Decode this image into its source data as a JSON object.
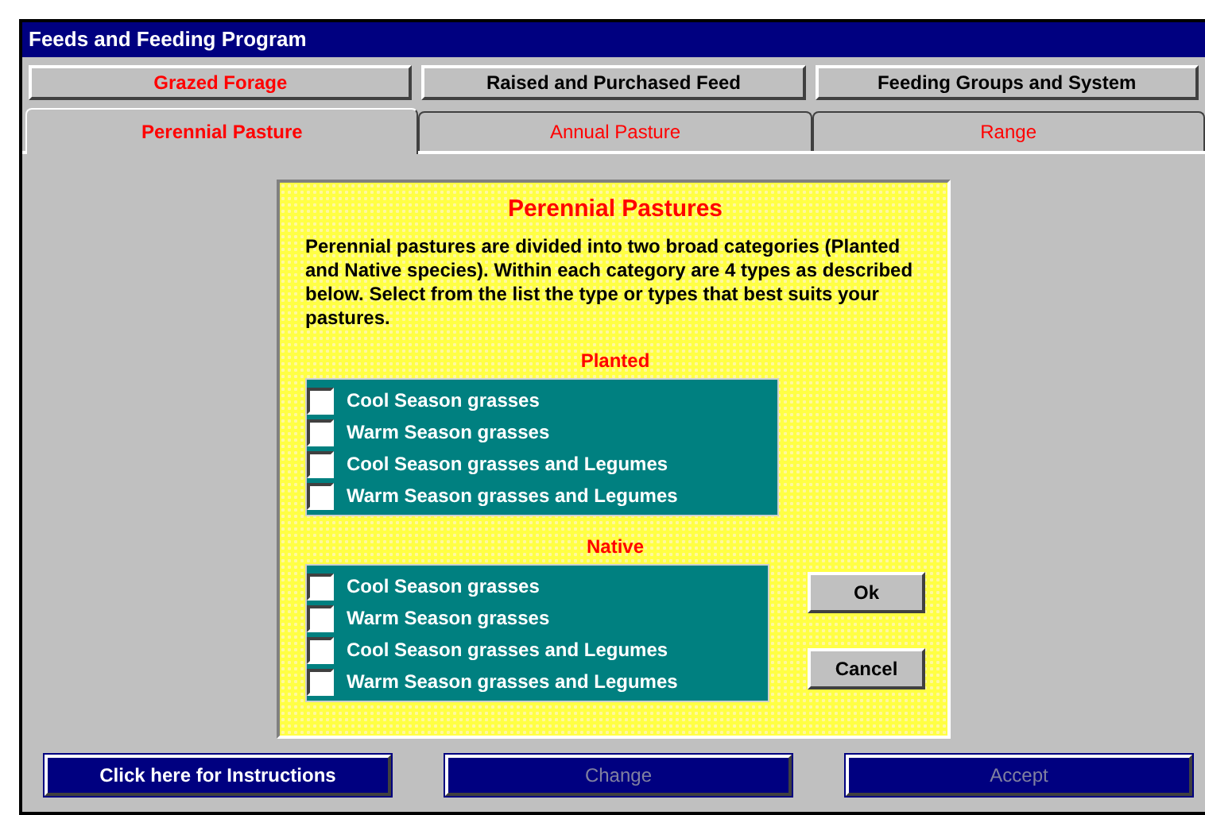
{
  "window": {
    "title": "Feeds and Feeding Program"
  },
  "sections": [
    {
      "label": "Grazed Forage",
      "selected": true
    },
    {
      "label": "Raised and Purchased Feed",
      "selected": false
    },
    {
      "label": "Feeding Groups and System",
      "selected": false
    }
  ],
  "tabs": [
    {
      "label": "Perennial Pasture",
      "selected": true
    },
    {
      "label": "Annual Pasture",
      "selected": false
    },
    {
      "label": "Range",
      "selected": false
    }
  ],
  "panel": {
    "title": "Perennial Pastures",
    "description": "Perennial pastures are divided into two broad categories (Planted and Native species).  Within each category are 4 types as described below.  Select from the list the type or types that best suits your pastures.",
    "groups": [
      {
        "heading": "Planted",
        "options": [
          {
            "label": "Cool Season grasses",
            "checked": false
          },
          {
            "label": "Warm Season grasses",
            "checked": false
          },
          {
            "label": "Cool Season grasses and Legumes",
            "checked": false
          },
          {
            "label": "Warm Season grasses and Legumes",
            "checked": false
          }
        ]
      },
      {
        "heading": "Native",
        "options": [
          {
            "label": "Cool Season grasses",
            "checked": false
          },
          {
            "label": "Warm Season grasses",
            "checked": false
          },
          {
            "label": "Cool Season grasses and Legumes",
            "checked": false
          },
          {
            "label": "Warm Season grasses and Legumes",
            "checked": false
          }
        ]
      }
    ],
    "buttons": [
      "Ok",
      "Cancel"
    ]
  },
  "footer": [
    {
      "label": "Click here for Instructions",
      "disabled": false
    },
    {
      "label": "Change",
      "disabled": true
    },
    {
      "label": "Accept",
      "disabled": true
    }
  ]
}
